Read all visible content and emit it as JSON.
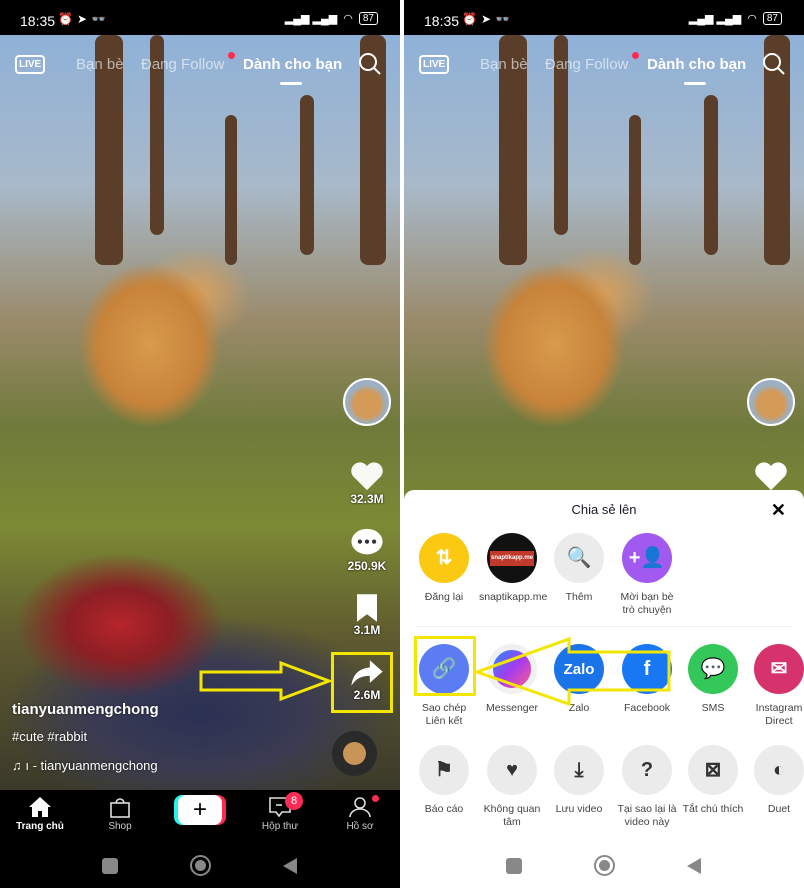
{
  "status": {
    "time": "18:35",
    "battery": "87"
  },
  "topnav": {
    "live": "LIVE",
    "tabs": [
      "Bạn bè",
      "Đang Follow",
      "Dành cho bạn"
    ],
    "active_tab": "Dành cho bạn"
  },
  "actions": {
    "likes": "32.3M",
    "comments": "250.9K",
    "saves": "3.1M",
    "shares": "2.6M"
  },
  "post": {
    "username": "tianyuanmengchong",
    "hashtags": "#cute #rabbit",
    "sound": "ı - tianyuanmengchong"
  },
  "bottom_nav": {
    "items": [
      "Trang chủ",
      "Shop",
      "",
      "Hộp thư",
      "Hồ sơ"
    ],
    "inbox_badge": "8"
  },
  "share_sheet": {
    "title": "Chia sẻ lên",
    "row1": [
      {
        "label": "Đăng lại",
        "icon": "repost-icon",
        "color": "#fcc912"
      },
      {
        "label": "snaptikapp.\nme",
        "icon": "contact-avatar",
        "color": "#111111",
        "logo_text": "snaptikapp.me"
      },
      {
        "label": "Thêm",
        "icon": "search-icon",
        "color": "#ebebeb"
      },
      {
        "label": "Mời bạn bè trò chuyện",
        "icon": "add-friend-icon",
        "color": "#a259f0"
      }
    ],
    "row2": [
      {
        "label": "Sao chép Liên kết",
        "icon": "link-icon",
        "color": "#5b7cf3"
      },
      {
        "label": "Messenger",
        "icon": "messenger-icon",
        "color": "#ffffff"
      },
      {
        "label": "Zalo",
        "icon": "zalo-icon",
        "color": "#1a73e8",
        "logo_text": "Zalo"
      },
      {
        "label": "Facebook",
        "icon": "facebook-icon",
        "color": "#1877f2"
      },
      {
        "label": "SMS",
        "icon": "sms-icon",
        "color": "#34c759"
      },
      {
        "label": "Instagram Direct",
        "icon": "instagram-direct-icon",
        "color": "#d6336c"
      }
    ],
    "row3": [
      {
        "label": "Báo cáo",
        "icon": "flag-icon"
      },
      {
        "label": "Không quan tâm",
        "icon": "broken-heart-icon"
      },
      {
        "label": "Lưu video",
        "icon": "download-icon"
      },
      {
        "label": "Tại sao lại là video này",
        "icon": "question-icon"
      },
      {
        "label": "Tắt chú thích",
        "icon": "captions-off-icon"
      },
      {
        "label": "Duet",
        "icon": "duet-icon"
      }
    ]
  },
  "colors": {
    "highlight": "#f3e600",
    "accent": "#fe2c55"
  }
}
